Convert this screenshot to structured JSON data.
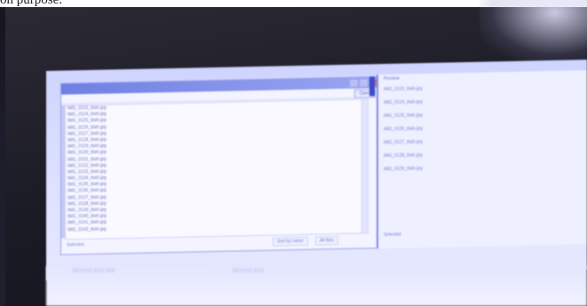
{
  "caption": "on purpose.",
  "colors": {
    "screen_bg": "#cfd4ff",
    "title_bar": "#6f7fe2",
    "accent": "#3d4bc9",
    "close_button": "#d16a7a"
  },
  "left_window": {
    "open_button_label": "Open",
    "files": [
      "IMG_0123_blah.jpg",
      "IMG_0124_blah.jpg",
      "IMG_0125_blah.jpg",
      "IMG_0126_blah.jpg",
      "IMG_0127_blah.jpg",
      "IMG_0128_blah.jpg",
      "IMG_0129_blah.jpg",
      "IMG_0130_blah.jpg",
      "IMG_0131_blah.jpg",
      "IMG_0132_blah.jpg",
      "IMG_0133_blah.jpg",
      "IMG_0134_blah.jpg",
      "IMG_0135_blah.jpg",
      "IMG_0136_blah.jpg",
      "IMG_0137_blah.jpg",
      "IMG_0138_blah.jpg",
      "IMG_0139_blah.jpg",
      "IMG_0140_blah.jpg",
      "IMG_0141_blah.jpg",
      "IMG_0142_blah.jpg"
    ],
    "footer_left": "Selected",
    "footer_mid_select": "Sort by name",
    "footer_right_select": "All files"
  },
  "right_window": {
    "header": "Preview",
    "rows": [
      "IMG_0123_blah.jpg",
      "IMG_0124_blah.jpg",
      "IMG_0125_blah.jpg",
      "IMG_0126_blah.jpg",
      "IMG_0127_blah.jpg",
      "IMG_0128_blah.jpg",
      "IMG_0129_blah.jpg"
    ],
    "footer": "Selected"
  },
  "bottom_area": {
    "line1": "blurred text line",
    "line2": "blurred text"
  }
}
